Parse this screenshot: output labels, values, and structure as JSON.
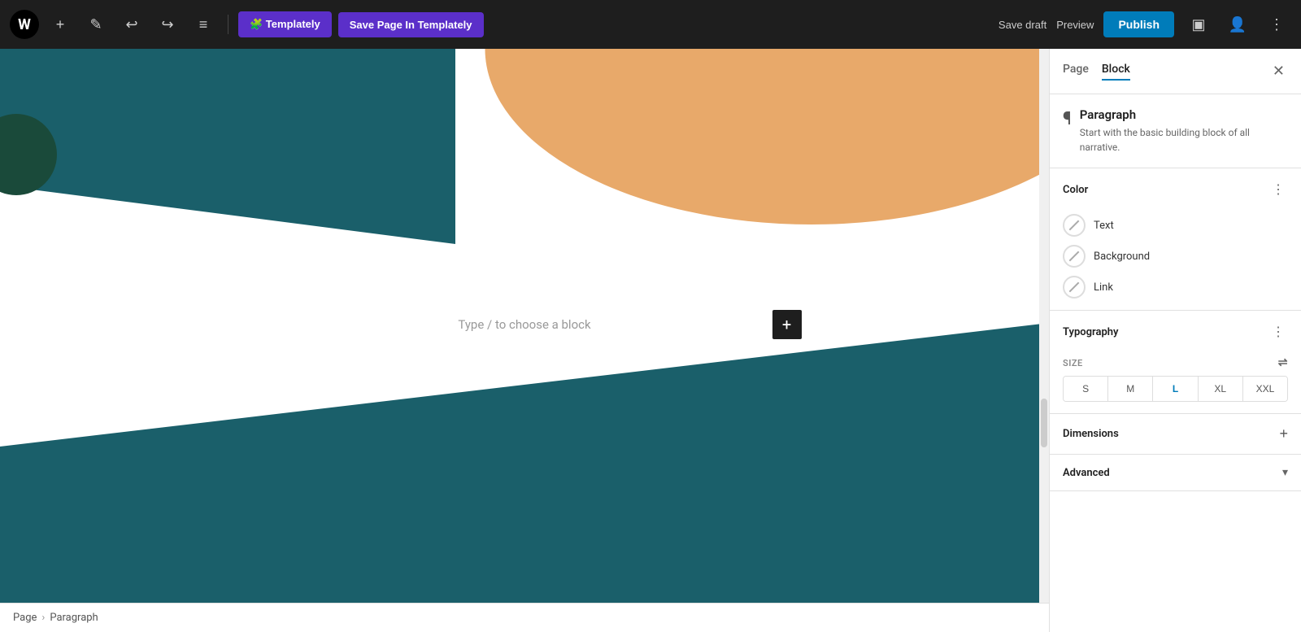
{
  "toolbar": {
    "wp_logo": "W",
    "add_label": "+",
    "edit_label": "✎",
    "undo_label": "↩",
    "redo_label": "↪",
    "menu_label": "≡",
    "templately_label": "🧩 Templately",
    "save_templately_label": "Save Page In Templately",
    "save_draft_label": "Save draft",
    "preview_label": "Preview",
    "publish_label": "Publish",
    "toggle_icon": "▣",
    "user_icon": "👤",
    "more_icon": "⋮"
  },
  "canvas": {
    "placeholder_text": "Type / to choose a block",
    "add_block_icon": "+"
  },
  "breadcrumb": {
    "page_label": "Page",
    "separator": "›",
    "paragraph_label": "Paragraph"
  },
  "right_panel": {
    "tab_page": "Page",
    "tab_block": "Block",
    "active_tab": "Block",
    "close_icon": "✕",
    "block_icon": "¶",
    "block_title": "Paragraph",
    "block_description": "Start with the basic building block of all narrative.",
    "color_section": {
      "title": "Color",
      "menu_icon": "⋮",
      "items": [
        {
          "label": "Text",
          "has_color": false
        },
        {
          "label": "Background",
          "has_color": false
        },
        {
          "label": "Link",
          "has_color": false
        }
      ]
    },
    "typography_section": {
      "title": "Typography",
      "menu_icon": "⋮",
      "size_label": "SIZE",
      "size_controls_icon": "⇌",
      "sizes": [
        "S",
        "M",
        "L",
        "XL",
        "XXL"
      ],
      "active_size": "L"
    },
    "dimensions_section": {
      "title": "Dimensions",
      "add_icon": "+"
    },
    "advanced_section": {
      "title": "Advanced",
      "chevron_icon": "▾"
    }
  }
}
